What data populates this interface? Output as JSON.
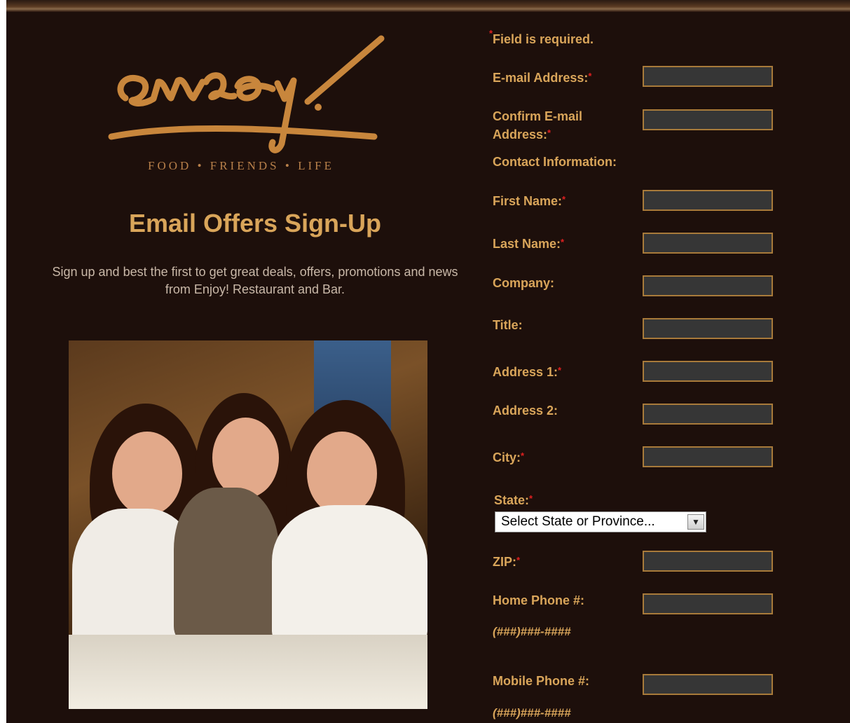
{
  "brand": {
    "logo_text": "enjoy!",
    "tagline": "FOOD • FRIENDS • LIFE"
  },
  "page": {
    "heading": "Email Offers Sign-Up",
    "intro": "Sign up and best the first to get great deals, offers, promotions and news from Enjoy! Restaurant and Bar."
  },
  "form": {
    "required_note": "Field is required.",
    "required_marker": "*",
    "fields": {
      "email": {
        "label": "E-mail Address:",
        "value": ""
      },
      "confirm_email": {
        "label": "Confirm E-mail Address:",
        "value": ""
      },
      "contact_section": {
        "label": "Contact Information:"
      },
      "first_name": {
        "label": "First Name:",
        "value": ""
      },
      "last_name": {
        "label": "Last Name:",
        "value": ""
      },
      "company": {
        "label": "Company:",
        "value": ""
      },
      "title": {
        "label": "Title:",
        "value": ""
      },
      "address1": {
        "label": "Address 1:",
        "value": ""
      },
      "address2": {
        "label": "Address 2:",
        "value": ""
      },
      "city": {
        "label": "City:",
        "value": ""
      },
      "state": {
        "label": "State:",
        "selected": "Select State or Province..."
      },
      "zip": {
        "label": "ZIP:",
        "value": ""
      },
      "home_phone": {
        "label": "Home Phone #:",
        "value": "",
        "hint": "(###)###-####"
      },
      "mobile_phone": {
        "label": "Mobile Phone #:",
        "value": "",
        "hint": "(###)###-####"
      }
    }
  },
  "colors": {
    "background": "#1d0f0b",
    "label": "#d9a55a",
    "field_bg": "#363636",
    "field_border": "#a87a3a",
    "required": "#e02020"
  }
}
